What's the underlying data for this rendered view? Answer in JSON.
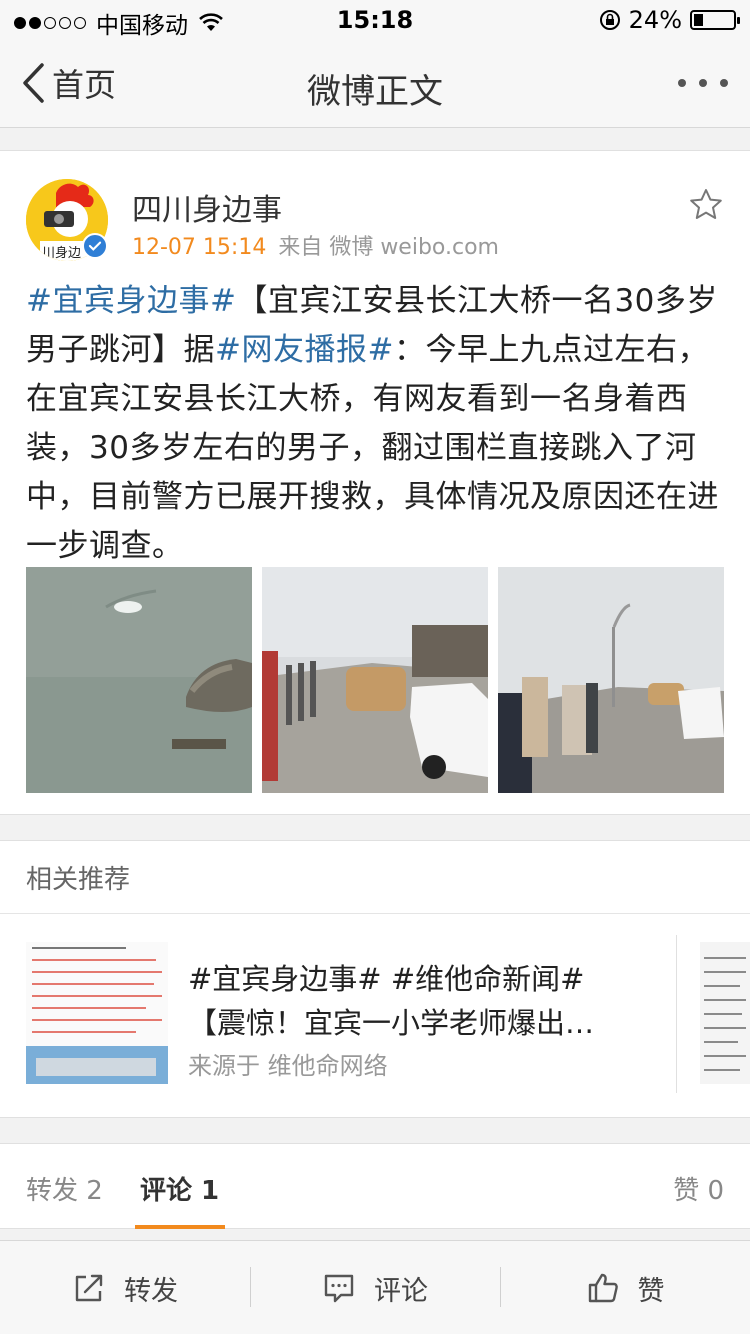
{
  "status_bar": {
    "carrier": "中国移动",
    "time": "15:18",
    "battery": "24%",
    "battery_level": 0.24,
    "signal_strength": 2
  },
  "nav": {
    "back_label": "首页",
    "title": "微博正文"
  },
  "post": {
    "author": "四川身边事",
    "time": "12-07 15:14",
    "source": "来自 微博 weibo.com",
    "text_segments": [
      {
        "text": "#宜宾身边事#",
        "tag": true
      },
      {
        "text": "【宜宾江安县长江大桥一名30多岁男子跳河】据",
        "tag": false
      },
      {
        "text": "#网友播报#",
        "tag": true
      },
      {
        "text": "：今早上九点过左右，在宜宾江安县长江大桥，有网友看到一名身着西装，30多岁左右的男子，翻过围栏直接跳入了河中，目前警方已展开搜救，具体情况及原因还在进一步调查。",
        "tag": false
      }
    ]
  },
  "related": {
    "header": "相关推荐",
    "title_line1": "#宜宾身边事# #维他命新闻#",
    "title_line2": "【震惊！宜宾一小学老师爆出…",
    "source": "来源于 维他命网络"
  },
  "tabs": {
    "repost": "转发 2",
    "comment": "评论 1",
    "like": "赞 0"
  },
  "bottom_bar": {
    "repost": "转发",
    "comment": "评论",
    "like": "赞"
  },
  "colors": {
    "accent": "#f28a1e",
    "tag": "#2e6da4",
    "verified": "#2f7fd6"
  }
}
